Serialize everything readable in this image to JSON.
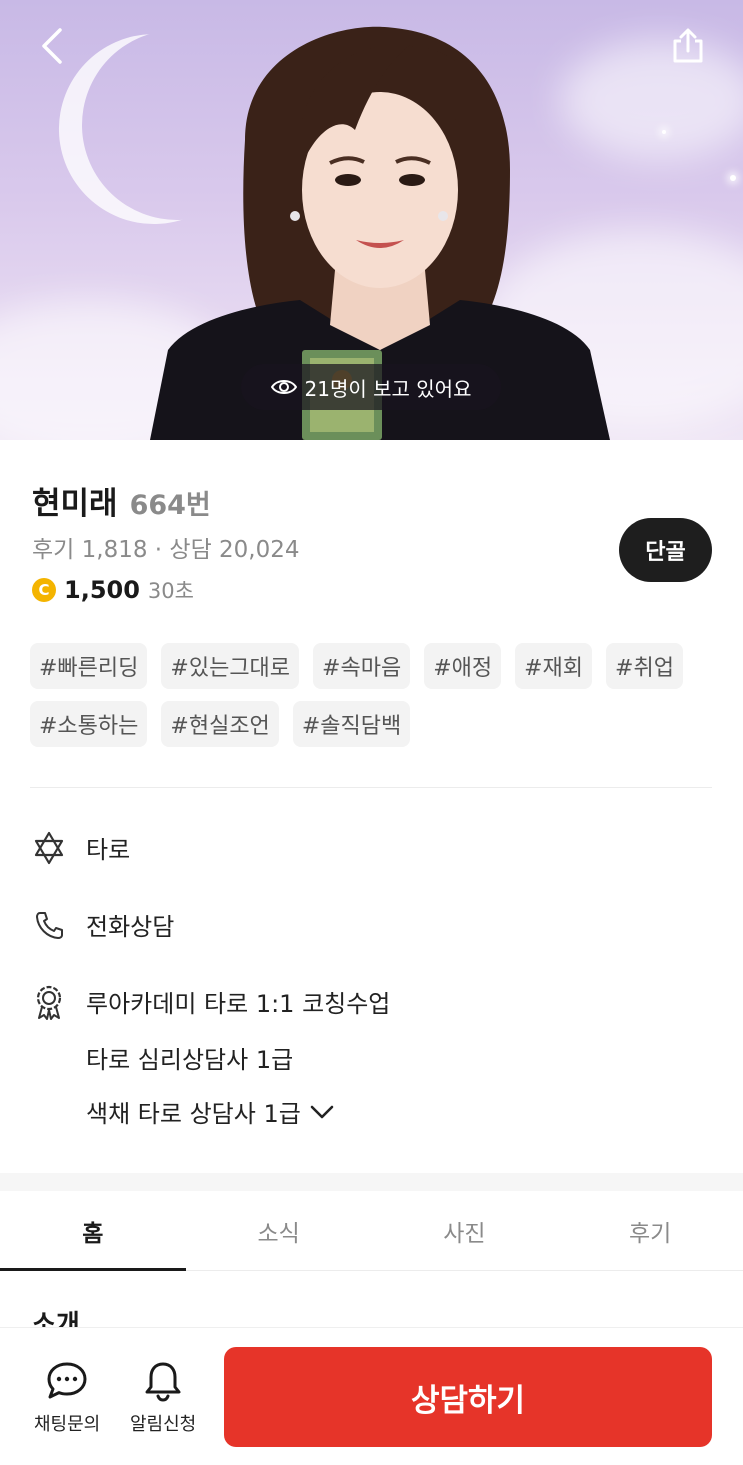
{
  "hero": {
    "viewer_text": "21명이 보고 있어요"
  },
  "profile": {
    "name": "현미래",
    "number": "664번",
    "stats": "후기 1,818 · 상담 20,024",
    "coin_symbol": "C",
    "price": "1,500",
    "unit": "30초",
    "badge_button": "단골"
  },
  "tags": [
    "#빠른리딩",
    "#있는그대로",
    "#속마음",
    "#애정",
    "#재회",
    "#취업",
    "#소통하는",
    "#현실조언",
    "#솔직담백"
  ],
  "info": {
    "category": "타로",
    "method": "전화상담",
    "certifications": [
      "루아카데미 타로 1:1 코칭수업",
      "타로 심리상담사 1급",
      "색채 타로 상담사 1급"
    ]
  },
  "tabs": [
    {
      "label": "홈",
      "active": true
    },
    {
      "label": "소식",
      "active": false
    },
    {
      "label": "사진",
      "active": false
    },
    {
      "label": "후기",
      "active": false
    }
  ],
  "section_peek": "소개",
  "bottom_bar": {
    "chat_label": "채팅문의",
    "alarm_label": "알림신청",
    "consult_label": "상담하기"
  },
  "colors": {
    "primary_red": "#e63429",
    "coin_gold": "#f4b400",
    "dark_button": "#1e1e1e"
  },
  "icons": [
    "back-icon",
    "share-icon",
    "eye-icon",
    "hexagram-icon",
    "phone-icon",
    "badge-icon",
    "chevron-down-icon",
    "chat-bubble-icon",
    "bell-icon"
  ]
}
